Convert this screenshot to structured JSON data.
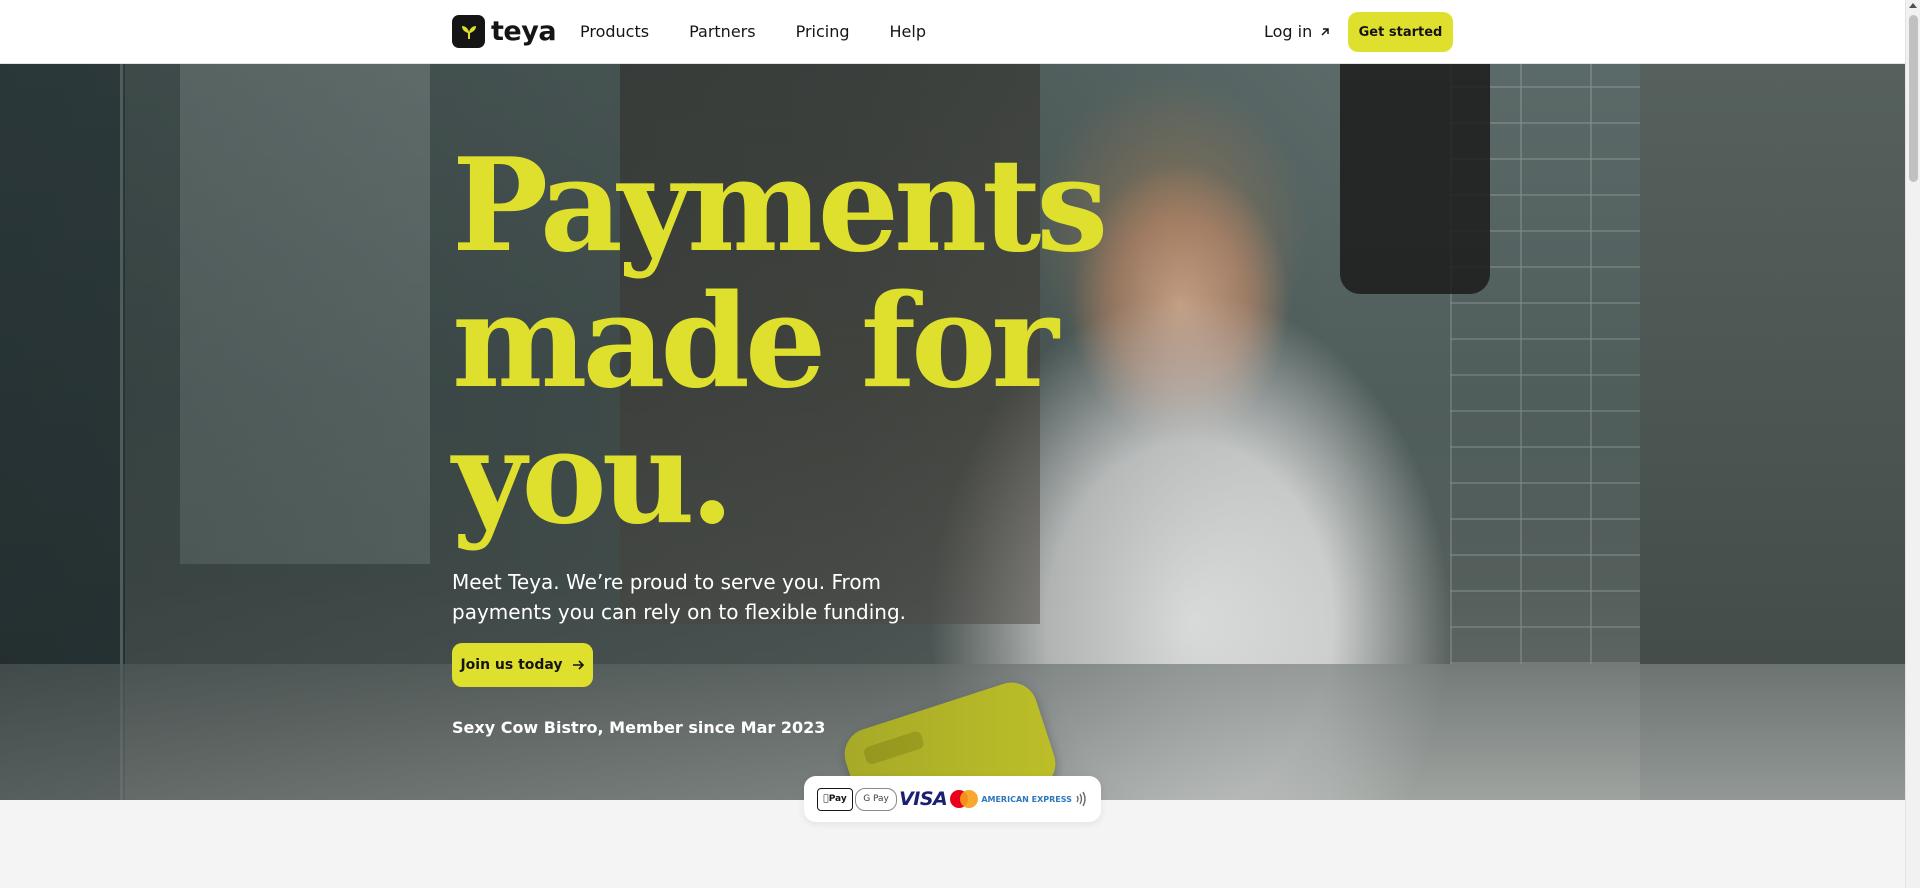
{
  "header": {
    "logo_text": "teya",
    "nav": [
      "Products",
      "Partners",
      "Pricing",
      "Help"
    ],
    "login_label": "Log in",
    "cta_label": "Get started"
  },
  "hero": {
    "title": "Payments made for you.",
    "description": "Meet Teya. We’re proud to serve you. From payments you can rely on to flexible funding.",
    "cta_label": "Join us today",
    "member_caption": "Sexy Cow Bistro, Member since Mar 2023"
  },
  "payments": {
    "apple_pay": "Pay",
    "google_pay": "G Pay",
    "visa": "VISA",
    "amex": "AMERICAN EXPRESS",
    "icons": [
      "apple-pay-icon",
      "google-pay-icon",
      "visa-icon",
      "mastercard-icon",
      "amex-icon",
      "contactless-icon"
    ]
  },
  "colors": {
    "accent": "#dfe02d",
    "text": "#151515",
    "page_bg": "#f4f4f5"
  }
}
